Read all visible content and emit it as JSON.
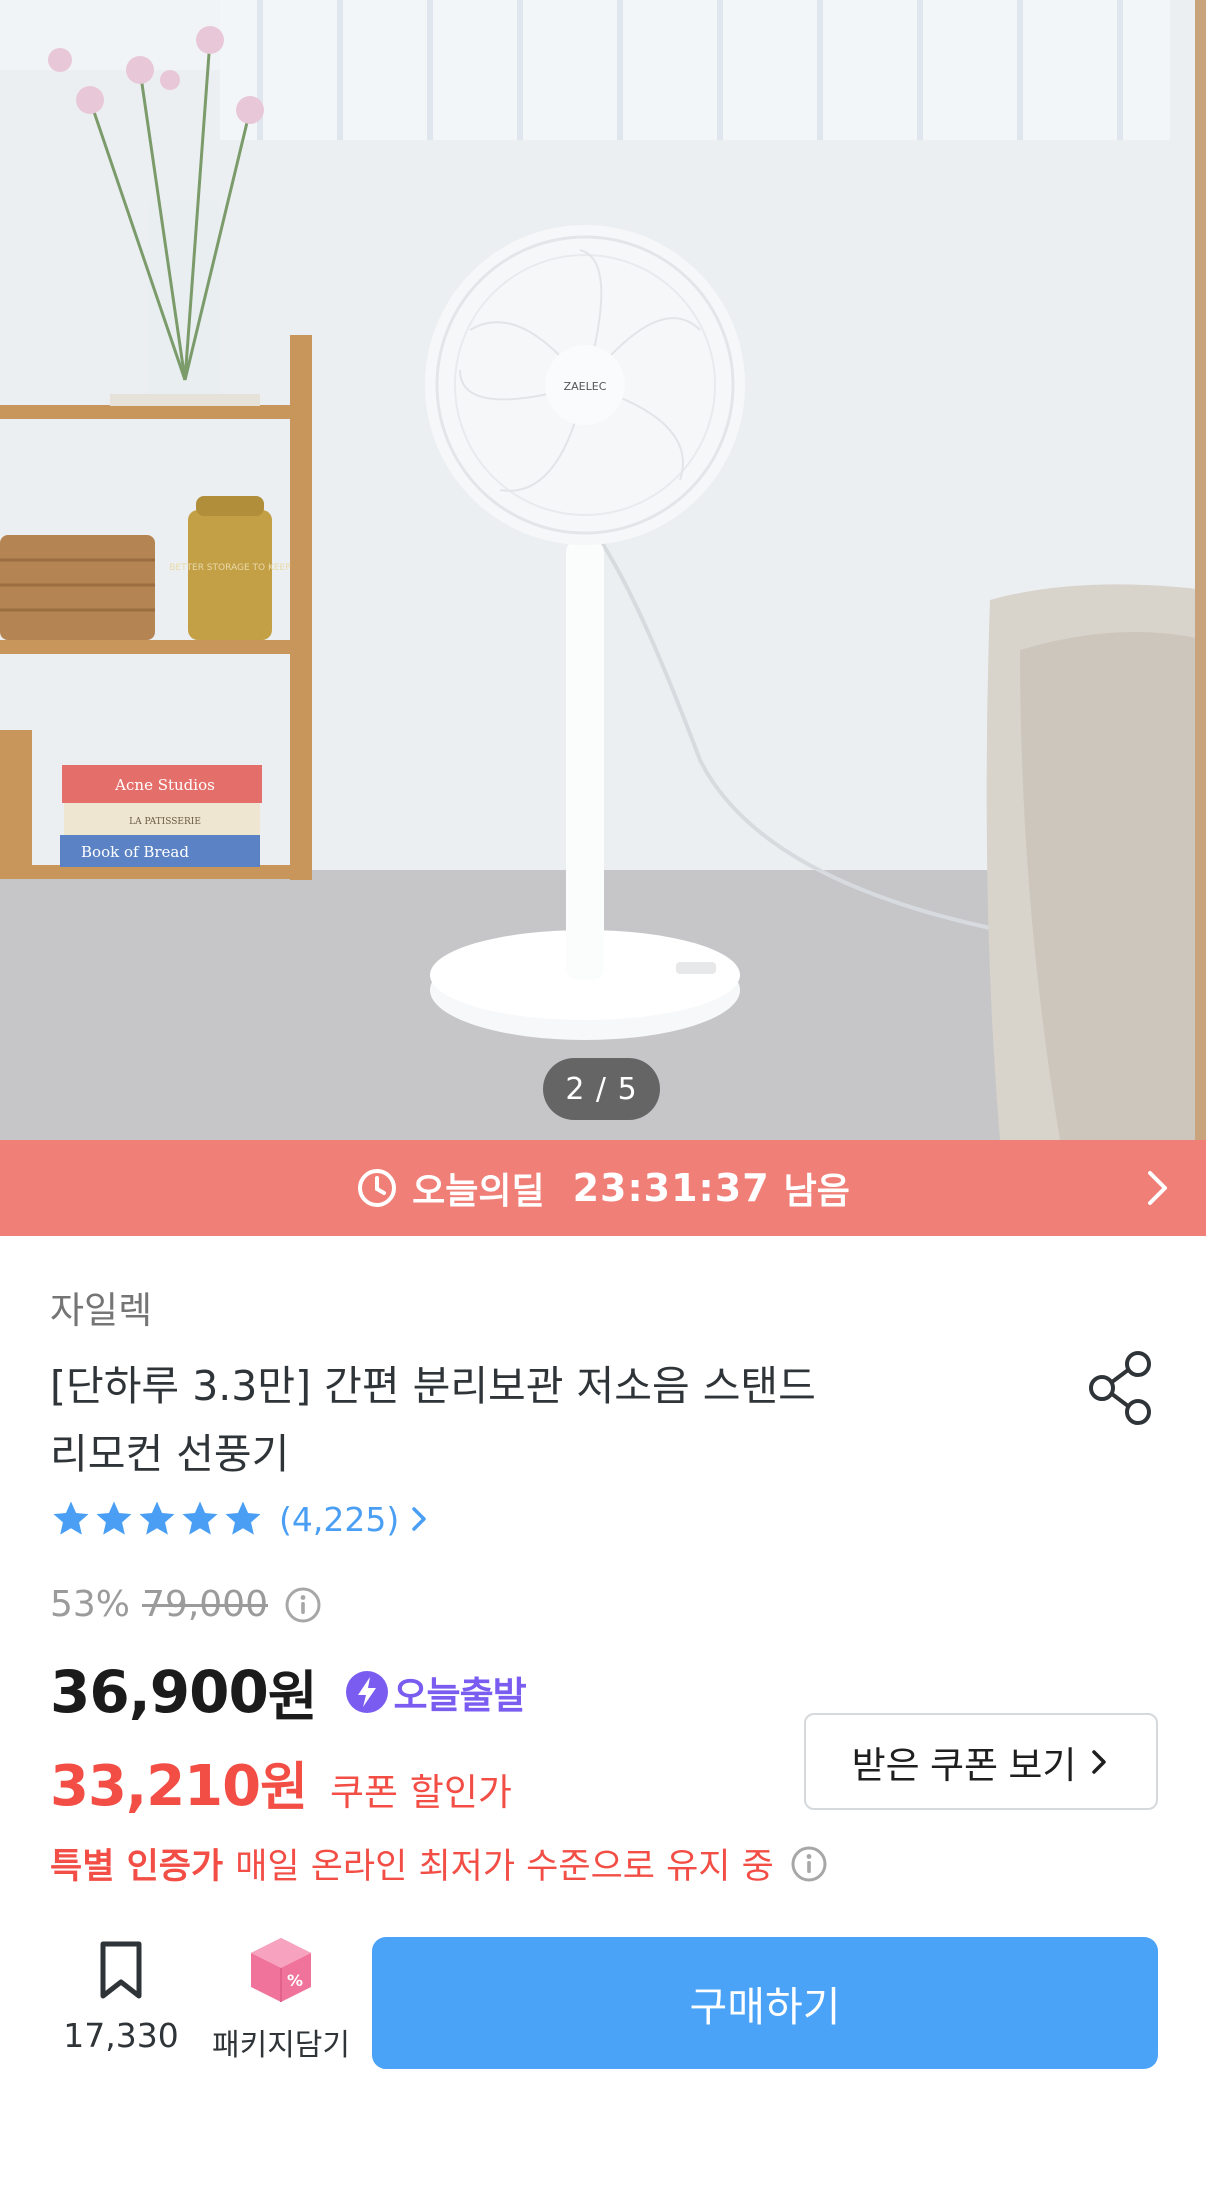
{
  "gallery": {
    "image_alt": "ZAELEC",
    "counter": "2 / 5",
    "book_titles": [
      "Acne Studios",
      "LA PATISSERIE",
      "Book of Bread"
    ],
    "jar_label": "BETTER STORAGE TO KEEP"
  },
  "deal": {
    "label": "오늘의딜",
    "timer": "23:31:37",
    "suffix": "남음"
  },
  "product": {
    "brand": "자일렉",
    "title_line1": "[단하루 3.3만] 간편 분리보관 저소음 스탠드",
    "title_line2": "리모컨 선풍기",
    "rating_count": "(4,225)",
    "rating": 5,
    "discount_percent": "53%",
    "original_price": "79,000",
    "price": "36,900",
    "price_unit": "원",
    "delivery_badge": "오늘출발",
    "coupon_price": "33,210",
    "coupon_price_unit": "원",
    "coupon_label": "쿠폰 할인가",
    "coupon_button": "받은 쿠폰 보기",
    "special_strong": "특별 인증가",
    "special_text": "매일 온라인 최저가 수준으로 유지 중"
  },
  "bottom_bar": {
    "bookmark_count": "17,330",
    "package_label": "패키지담기",
    "buy_label": "구매하기"
  },
  "colors": {
    "deal_bg": "#f07f78",
    "accent_blue": "#4aa3f7",
    "red": "#f24e46",
    "badge_purple": "#7a5cf0"
  },
  "icons": [
    "clock-icon",
    "chevron-right-icon",
    "share-icon",
    "star-icon",
    "info-icon",
    "bolt-icon",
    "bookmark-icon",
    "package-box-icon"
  ]
}
